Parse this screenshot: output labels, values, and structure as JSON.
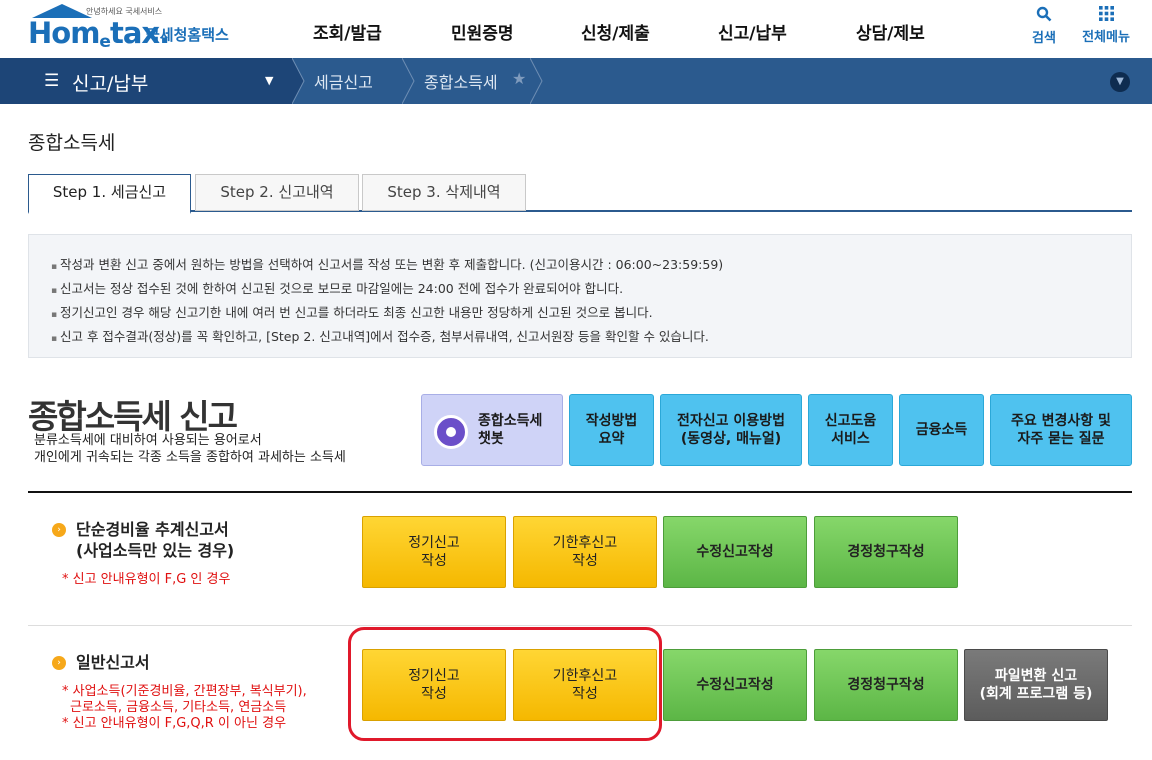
{
  "header": {
    "logo_small": "안녕하세요 국세서비스",
    "logo_main_a": "Hom",
    "logo_main_e": "e",
    "logo_main_b": "tax.",
    "logo_sub": "국세청홈택스",
    "menu": [
      "조회/발급",
      "민원증명",
      "신청/제출",
      "신고/납부",
      "상담/제보"
    ],
    "search_label": "검색",
    "allmenu_label": "전체메뉴",
    "search_icon": "magnifier",
    "allmenu_icon": "grid-3x3"
  },
  "navbar": {
    "current": "신고/납부",
    "crumbs": [
      "세금신고",
      "종합소득세"
    ]
  },
  "page": {
    "title": "종합소득세",
    "tabs": [
      "Step 1. 세금신고",
      "Step 2. 신고내역",
      "Step 3. 삭제내역"
    ],
    "notice": [
      "작성과 변환 신고 중에서 원하는 방법을 선택하여 신고서를 작성 또는 변환 후 제출합니다. (신고이용시간 : 06:00~23:59:59)",
      "신고서는 정상 접수된 것에 한하여 신고된 것으로 보므로 마감일에는 24:00 전에 접수가 완료되어야 합니다.",
      "정기신고인 경우 해당 신고기한 내에 여러 번 신고를 하더라도 최종 신고한 내용만 정당하게 신고된 것으로 봅니다.",
      "신고 후 접수결과(정상)를 꼭 확인하고, [Step 2. 신고내역]에서 접수증, 첨부서류내역, 신고서원장 등을 확인할 수 있습니다."
    ]
  },
  "section": {
    "title": "종합소득세 신고",
    "desc1": "분류소득세에 대비하여 사용되는 용어로서",
    "desc2": "개인에게 귀속되는 각종 소득을 종합하여 과세하는 소득세",
    "chatbot_line1": "종합소득세",
    "chatbot_line2": "챗봇",
    "quick_buttons": [
      {
        "l1": "작성방법",
        "l2": "요약"
      },
      {
        "l1": "전자신고 이용방법",
        "l2": "(동영상, 매뉴얼)"
      },
      {
        "l1": "신고도움",
        "l2": "서비스"
      },
      {
        "l1": "금융소득",
        "l2": ""
      },
      {
        "l1": "주요 변경사항 및",
        "l2": "자주 묻는 질문"
      }
    ]
  },
  "row1": {
    "title1": "단순경비율 추계신고서",
    "title2": "(사업소득만 있는 경우)",
    "note": "* 신고 안내유형이 F,G 인 경우",
    "btn_regular": {
      "l1": "정기신고",
      "l2": "작성"
    },
    "btn_late": {
      "l1": "기한후신고",
      "l2": "작성"
    },
    "btn_amend": "수정신고작성",
    "btn_claim": "경정청구작성"
  },
  "row2": {
    "title": "일반신고서",
    "note1": "* 사업소득(기준경비율, 간편장부, 복식부기),",
    "note2": "근로소득, 금융소득, 기타소득, 연금소득",
    "note3": "* 신고 안내유형이 F,G,Q,R 이 아닌 경우",
    "btn_regular": {
      "l1": "정기신고",
      "l2": "작성"
    },
    "btn_late": {
      "l1": "기한후신고",
      "l2": "작성"
    },
    "btn_amend": "수정신고작성",
    "btn_claim": "경정청구작성",
    "btn_file": {
      "l1": "파일변환 신고",
      "l2": "(회계 프로그램 등)"
    }
  },
  "colors": {
    "brand": "#1b6fb8",
    "nav": "#2b5a8e",
    "yellow": "#f5b800",
    "green": "#5cb646",
    "highlight": "#e0192b"
  }
}
